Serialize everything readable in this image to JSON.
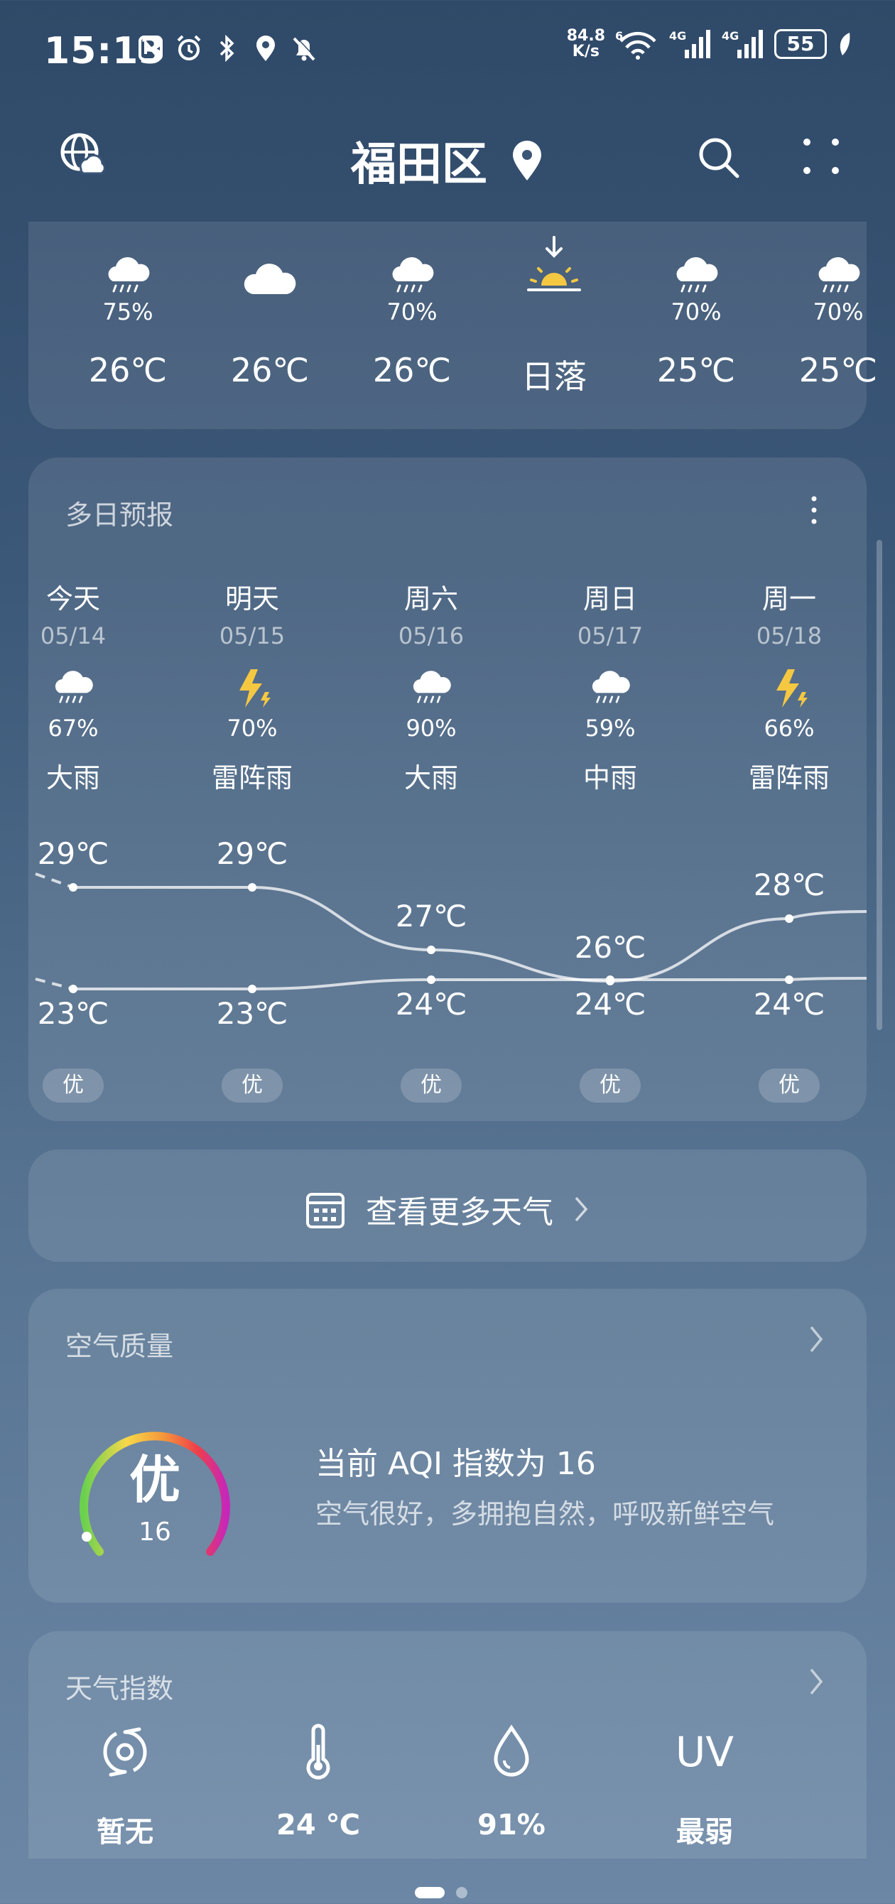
{
  "status_bar": {
    "time": "15:13",
    "net_speed_value": "84.8",
    "net_speed_unit": "K/s",
    "signal1_label": "4G",
    "signal2_label": "4G",
    "wifi_label": "6",
    "battery": "55"
  },
  "header": {
    "title": "福田区"
  },
  "hourly": {
    "items": [
      {
        "icon": "rain-cloud-icon",
        "pct": "75%",
        "temp": "26℃"
      },
      {
        "icon": "cloud-icon",
        "pct": "",
        "temp": "26℃"
      },
      {
        "icon": "rain-cloud-icon",
        "pct": "70%",
        "temp": "26℃"
      },
      {
        "icon": "sunset-icon",
        "pct": "",
        "temp": "日落"
      },
      {
        "icon": "rain-cloud-icon",
        "pct": "70%",
        "temp": "25℃"
      },
      {
        "icon": "rain-cloud-icon",
        "pct": "70%",
        "temp": "25℃"
      }
    ]
  },
  "daily": {
    "title": "多日预报",
    "days": [
      {
        "name": "今天",
        "date": "05/14",
        "icon": "rain-cloud-icon",
        "pct": "67%",
        "desc": "大雨",
        "hi": "29℃",
        "lo": "23℃",
        "aqi": "优"
      },
      {
        "name": "明天",
        "date": "05/15",
        "icon": "thunder-icon",
        "pct": "70%",
        "desc": "雷阵雨",
        "hi": "29℃",
        "lo": "23℃",
        "aqi": "优"
      },
      {
        "name": "周六",
        "date": "05/16",
        "icon": "rain-cloud-icon",
        "pct": "90%",
        "desc": "大雨",
        "hi": "27℃",
        "lo": "24℃",
        "aqi": "优"
      },
      {
        "name": "周日",
        "date": "05/17",
        "icon": "rain-cloud-icon",
        "pct": "59%",
        "desc": "中雨",
        "hi": "26℃",
        "lo": "24℃",
        "aqi": "优"
      },
      {
        "name": "周一",
        "date": "05/18",
        "icon": "thunder-icon",
        "pct": "66%",
        "desc": "雷阵雨",
        "hi": "28℃",
        "lo": "24℃",
        "aqi": "优"
      }
    ],
    "hi_values": [
      29,
      29,
      27,
      26,
      28
    ],
    "lo_values": [
      23,
      23,
      24,
      24,
      24
    ]
  },
  "more_weather": {
    "label": "查看更多天气"
  },
  "air_quality": {
    "title": "空气质量",
    "level": "优",
    "aqi": "16",
    "headline": "当前 AQI 指数为 16",
    "advice": "空气很好，多拥抱自然，呼吸新鲜空气"
  },
  "weather_index": {
    "title": "天气指数",
    "items": [
      {
        "icon": "typhoon-icon",
        "value": "暂无"
      },
      {
        "icon": "thermometer-icon",
        "value": "24 ℃"
      },
      {
        "icon": "humidity-drop-icon",
        "value": "91%"
      },
      {
        "icon": "uv-icon",
        "icon_text": "UV",
        "value": "最弱"
      }
    ]
  }
}
